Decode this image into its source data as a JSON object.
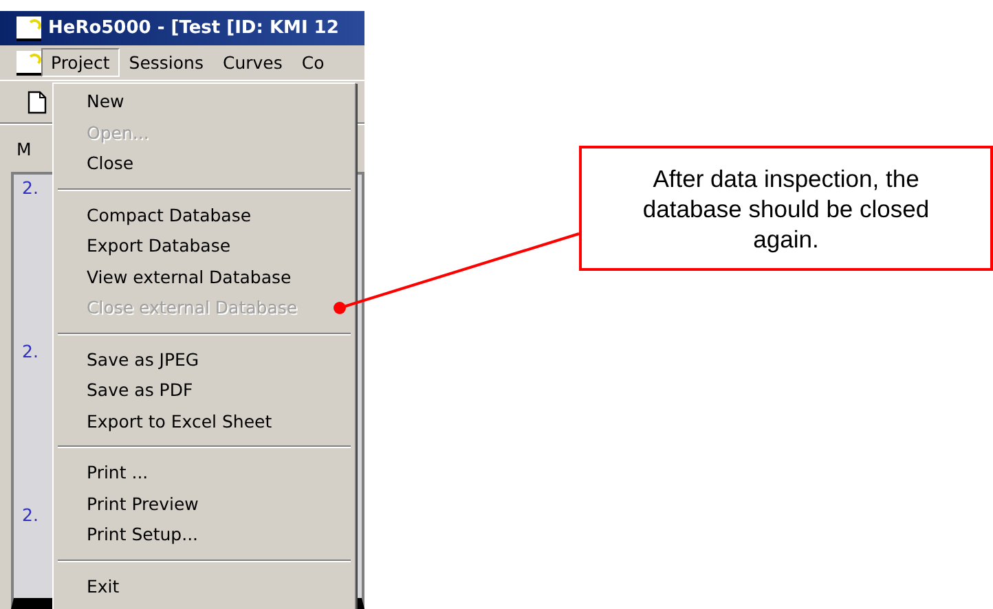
{
  "window": {
    "title": "HeRo5000 - [Test [ID: KMI 12"
  },
  "menu_bar": [
    {
      "label": "Project",
      "selected": true
    },
    {
      "label": "Sessions",
      "selected": false
    },
    {
      "label": "Curves",
      "selected": false
    },
    {
      "label": "Co",
      "selected": false
    }
  ],
  "tab_row": {
    "label": "M"
  },
  "axis_labels": [
    "2.",
    "2.",
    "2."
  ],
  "project_menu": [
    {
      "kind": "item",
      "label": "New",
      "disabled": false
    },
    {
      "kind": "item",
      "label": "Open...",
      "disabled": true
    },
    {
      "kind": "item",
      "label": "Close",
      "disabled": false
    },
    {
      "kind": "separator"
    },
    {
      "kind": "item",
      "label": "Compact Database",
      "disabled": false
    },
    {
      "kind": "item",
      "label": "Export Database",
      "disabled": false
    },
    {
      "kind": "item",
      "label": "View external Database",
      "disabled": false
    },
    {
      "kind": "item",
      "label": "Close external Database",
      "disabled": true
    },
    {
      "kind": "separator"
    },
    {
      "kind": "item",
      "label": "Save as JPEG",
      "disabled": false
    },
    {
      "kind": "item",
      "label": "Save as PDF",
      "disabled": false
    },
    {
      "kind": "item",
      "label": "Export to Excel Sheet",
      "disabled": false
    },
    {
      "kind": "separator"
    },
    {
      "kind": "item",
      "label": "Print ...",
      "disabled": false
    },
    {
      "kind": "item",
      "label": "Print Preview",
      "disabled": false
    },
    {
      "kind": "item",
      "label": "Print Setup...",
      "disabled": false
    },
    {
      "kind": "separator"
    },
    {
      "kind": "item",
      "label": "Exit",
      "disabled": false
    }
  ],
  "callout": {
    "text": "After data inspection, the database should be closed again."
  }
}
